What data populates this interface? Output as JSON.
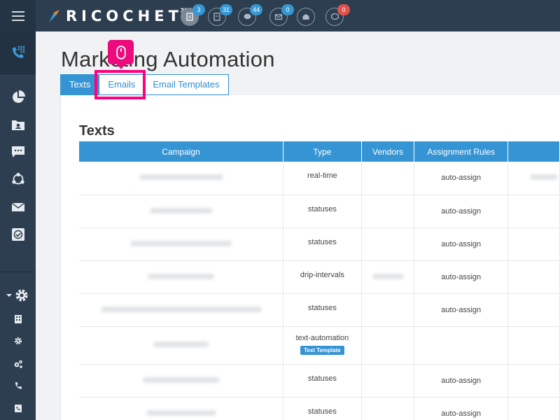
{
  "app": {
    "logo_text": "RICOCHET",
    "logo_sup": "360"
  },
  "notifications": [
    {
      "icon": "document-icon",
      "count": "3",
      "color": "#3597d3"
    },
    {
      "icon": "document-alt-icon",
      "count": "31",
      "color": "#3597d3"
    },
    {
      "icon": "chat-icon",
      "count": "44",
      "color": "#3597d3"
    },
    {
      "icon": "email-icon",
      "count": "0",
      "color": "#3597d3"
    },
    {
      "icon": "envelope-open-icon",
      "count": "",
      "color": ""
    },
    {
      "icon": "speech-bubble-icon",
      "count": "0",
      "color": "#e0524d"
    }
  ],
  "page": {
    "title": "Marketing Automation",
    "section_title": "Texts"
  },
  "tabs": [
    {
      "label": "Texts",
      "active": true
    },
    {
      "label": "Emails",
      "active": false
    },
    {
      "label": "Email Templates",
      "active": false
    }
  ],
  "table": {
    "headers": [
      "Campaign",
      "Type",
      "Vendors",
      "Assignment Rules",
      ""
    ],
    "rows": [
      {
        "type": "real-time",
        "assignment": "auto-assign",
        "tag": ""
      },
      {
        "type": "statuses",
        "assignment": "auto-assign",
        "tag": ""
      },
      {
        "type": "statuses",
        "assignment": "auto-assign",
        "tag": ""
      },
      {
        "type": "drip-intervals",
        "assignment": "auto-assign",
        "tag": ""
      },
      {
        "type": "statuses",
        "assignment": "auto-assign",
        "tag": ""
      },
      {
        "type": "text-automation",
        "assignment": "",
        "tag": "Text Template"
      },
      {
        "type": "statuses",
        "assignment": "auto-assign",
        "tag": ""
      },
      {
        "type": "statuses",
        "assignment": "auto-assign",
        "tag": ""
      }
    ]
  },
  "colors": {
    "primary": "#3594d4",
    "nav_bg": "#2d3e50",
    "highlight": "#ff007f"
  }
}
